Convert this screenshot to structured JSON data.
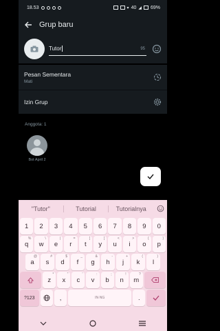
{
  "status": {
    "time": "18.53",
    "network": "40",
    "battery": "69%"
  },
  "header": {
    "title": "Grup baru"
  },
  "group_name": {
    "value": "Tutor",
    "counter": "95"
  },
  "settings": [
    {
      "title": "Pesan Sementara",
      "subtitle": "Mati"
    },
    {
      "title": "Izin Grup",
      "subtitle": ""
    }
  ],
  "members": {
    "label": "Anggota: 1",
    "items": [
      {
        "name": "Bot April 2"
      }
    ]
  },
  "keyboard": {
    "suggestions": [
      "\"Tutor\"",
      "Tutorial",
      "Tutorialnya"
    ],
    "row_numbers": [
      "1",
      "2",
      "3",
      "4",
      "5",
      "6",
      "7",
      "8",
      "9",
      "0"
    ],
    "row1": [
      {
        "k": "q",
        "s": "%"
      },
      {
        "k": "w",
        "s": "\\"
      },
      {
        "k": "e",
        "s": "|"
      },
      {
        "k": "r",
        "s": "="
      },
      {
        "k": "t",
        "s": "["
      },
      {
        "k": "y",
        "s": "]"
      },
      {
        "k": "u",
        "s": "<"
      },
      {
        "k": "i",
        "s": ">"
      },
      {
        "k": "o",
        "s": "{"
      },
      {
        "k": "p",
        "s": "}"
      }
    ],
    "row2": [
      {
        "k": "a",
        "s": "@"
      },
      {
        "k": "s",
        "s": "#"
      },
      {
        "k": "d",
        "s": "$"
      },
      {
        "k": "f",
        "s": "_"
      },
      {
        "k": "g",
        "s": "&"
      },
      {
        "k": "h",
        "s": "-"
      },
      {
        "k": "j",
        "s": "+"
      },
      {
        "k": "k",
        "s": "("
      },
      {
        "k": "l",
        "s": ")"
      }
    ],
    "row3": [
      {
        "k": "z",
        "s": "*"
      },
      {
        "k": "x",
        "s": "\""
      },
      {
        "k": "c",
        "s": "'"
      },
      {
        "k": "v",
        "s": ":"
      },
      {
        "k": "b",
        "s": ";"
      },
      {
        "k": "n",
        "s": "!"
      },
      {
        "k": "m",
        "s": "?"
      }
    ],
    "symbols_key": "?123",
    "comma_key": ",",
    "period_key": ".",
    "space_label": "IN·NG"
  },
  "colors": {
    "background": "#000000",
    "panel": "#161b1f",
    "keyboard": "#f6dbe6",
    "fab": "#ffffff"
  }
}
